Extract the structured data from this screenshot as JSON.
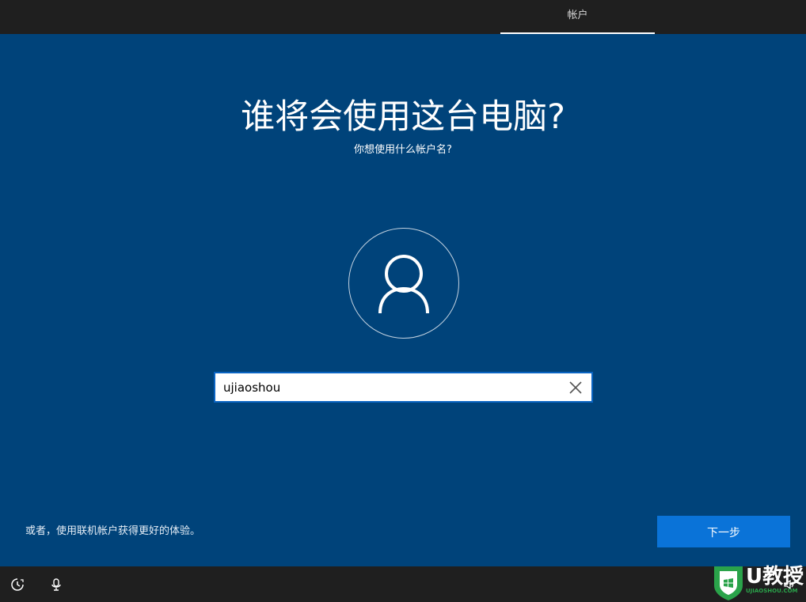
{
  "header": {
    "tab_label": "帐户"
  },
  "main": {
    "title": "谁将会使用这台电脑?",
    "subtitle": "你想使用什么帐户名?",
    "avatar_icon": "user-icon",
    "username_value": "ujiaoshou",
    "clear_icon": "close-icon",
    "alt_link": "或者，使用联机帐户获得更好的体验。",
    "next_button": "下一步"
  },
  "bottom": {
    "icons": [
      "ease-of-access-icon",
      "microphone-icon",
      "speaker-icon"
    ]
  },
  "watermark": {
    "brand_main": "U教授",
    "brand_sub": "UJIAOSHOU.COM"
  },
  "colors": {
    "background": "#00437a",
    "bar": "#1f1f1f",
    "accent": "#0a73d8",
    "logo_green": "#2aa34a"
  }
}
